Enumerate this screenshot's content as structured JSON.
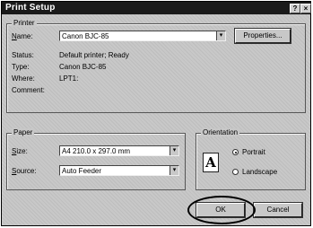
{
  "window": {
    "title": "Print Setup",
    "help_glyph": "?",
    "close_glyph": "×"
  },
  "printer": {
    "group_label": "Printer",
    "name_label_prefix": "",
    "name_label_key": "N",
    "name_label_rest": "ame:",
    "name_value": "Canon BJC-85",
    "properties_label": "Properties...",
    "status_label": "Status:",
    "status_value": "Default printer; Ready",
    "type_label": "Type:",
    "type_value": "Canon BJC-85",
    "where_label": "Where:",
    "where_value": "LPT1:",
    "comment_label": "Comment:"
  },
  "paper": {
    "group_label": "Paper",
    "size_label_key": "S",
    "size_label_rest": "ize:",
    "size_value": "A4 210.0 x 297.0 mm",
    "source_label_key": "S",
    "source_label_rest": "ource:",
    "source_value": "Auto Feeder"
  },
  "orientation": {
    "group_label": "Orientation",
    "icon_letter": "A",
    "portrait_label": "Portrait",
    "landscape_label": "Landscape",
    "selected": "portrait"
  },
  "buttons": {
    "ok": "OK",
    "cancel": "Cancel"
  },
  "dropdown_glyph": "▾"
}
